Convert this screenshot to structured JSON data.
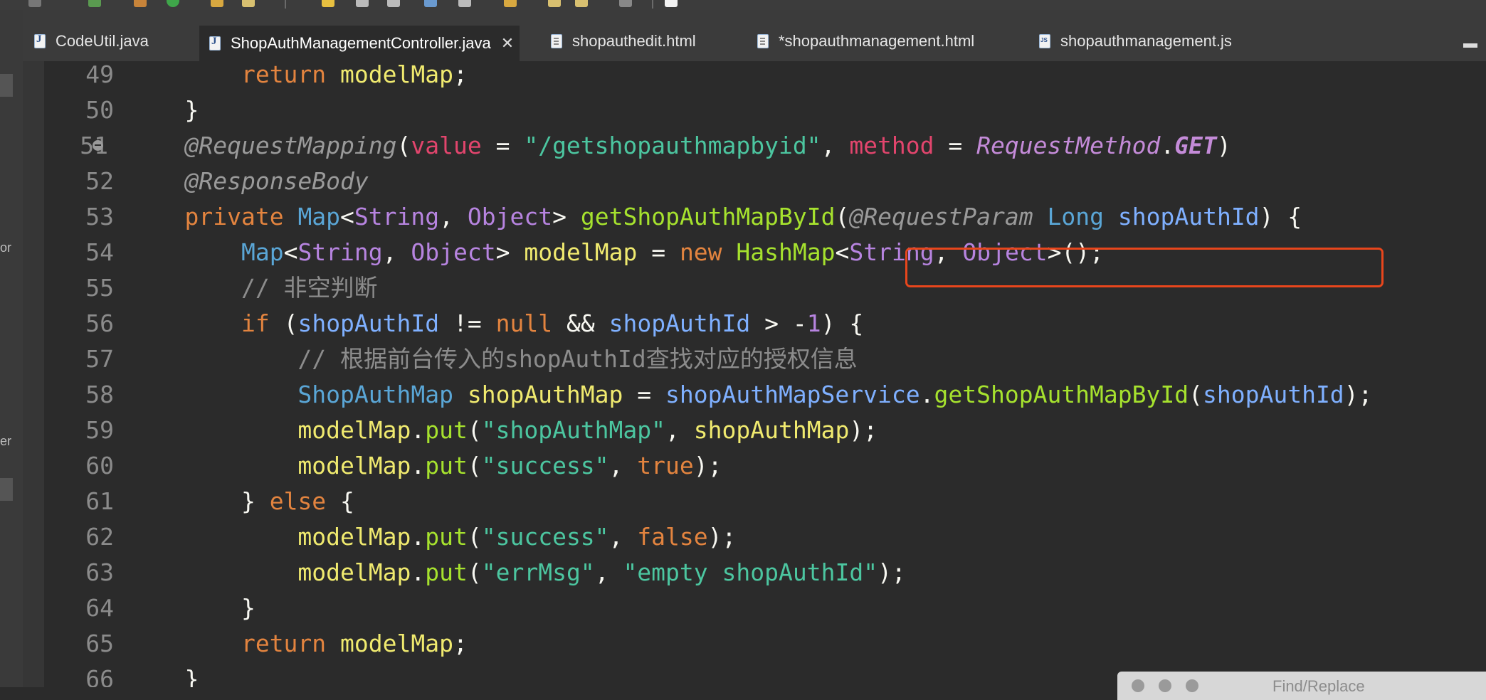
{
  "tabs": [
    {
      "label": "CodeUtil.java",
      "icon": "java-file-icon"
    },
    {
      "label": "ShopAuthManagementController.java",
      "icon": "java-file-icon",
      "active": true
    },
    {
      "label": "shopauthedit.html",
      "icon": "html-file-icon"
    },
    {
      "label": "*shopauthmanagement.html",
      "icon": "html-file-icon"
    },
    {
      "label": "shopauthmanagement.js",
      "icon": "js-file-icon"
    }
  ],
  "left_panel": {
    "fragment_1": "or",
    "fragment_2": "er"
  },
  "editor": {
    "line_numbers": [
      "49",
      "50",
      "51",
      "52",
      "53",
      "54",
      "55",
      "56",
      "57",
      "58",
      "59",
      "60",
      "61",
      "62",
      "63",
      "64",
      "65",
      "66"
    ],
    "highlighted_param": "@RequestParam Long shopAuthId",
    "code": {
      "l49": {
        "kw": "return",
        "var": "modelMap",
        "end": ";"
      },
      "l50": {
        "text": "}"
      },
      "l51": {
        "ann": "@RequestMapping",
        "open": "(",
        "k1": "value",
        "eq": " = ",
        "s1": "\"/getshopauthmapbyid\"",
        "comma": ", ",
        "k2": "method",
        "eq2": " = ",
        "e1": "RequestMethod",
        "dot": ".",
        "e2": "GET",
        "close": ")"
      },
      "l52": {
        "ann": "@ResponseBody"
      },
      "l53": {
        "kw": "private",
        "t1": "Map",
        "lt": "<",
        "g1": "String",
        "comma": ", ",
        "g2": "Object",
        "gt": ">",
        "fn": "getShopAuthMapById",
        "open": "(",
        "ann": "@RequestParam",
        "t2": "Long",
        "par": "shopAuthId",
        "close": ")",
        "brace": " {"
      },
      "l54": {
        "t1": "Map",
        "lt": "<",
        "g1": "String",
        "comma": ", ",
        "g2": "Object",
        "gt": ">",
        "var": "modelMap",
        "eq": " = ",
        "kw": "new",
        "fn": "HashMap",
        "lt2": "<",
        "g3": "String",
        "comma2": ", ",
        "g4": "Object",
        "end": ">();"
      },
      "l55": {
        "cmt": "// 非空判断"
      },
      "l56": {
        "kw": "if",
        "open": " (",
        "p1": "shopAuthId",
        "op1": " != ",
        "lit": "null",
        "op2": " && ",
        "p2": "shopAuthId",
        "op3": " > -",
        "num": "1",
        "close": ") {"
      },
      "l57": {
        "cmt": "// 根据前台传入的shopAuthId查找对应的授权信息"
      },
      "l58": {
        "t1": "ShopAuthMap",
        "var": "shopAuthMap",
        "eq": " = ",
        "p1": "shopAuthMapService",
        "dot": ".",
        "fn": "getShopAuthMapById",
        "open": "(",
        "p2": "shopAuthId",
        "end": ");"
      },
      "l59": {
        "var": "modelMap",
        "dot": ".",
        "fn": "put",
        "open": "(",
        "s1": "\"shopAuthMap\"",
        "comma": ", ",
        "v2": "shopAuthMap",
        "end": ");"
      },
      "l60": {
        "var": "modelMap",
        "dot": ".",
        "fn": "put",
        "open": "(",
        "s1": "\"success\"",
        "comma": ", ",
        "lit": "true",
        "end": ");"
      },
      "l61": {
        "b1": "} ",
        "kw": "else",
        "b2": " {"
      },
      "l62": {
        "var": "modelMap",
        "dot": ".",
        "fn": "put",
        "open": "(",
        "s1": "\"success\"",
        "comma": ", ",
        "lit": "false",
        "end": ");"
      },
      "l63": {
        "var": "modelMap",
        "dot": ".",
        "fn": "put",
        "open": "(",
        "s1": "\"errMsg\"",
        "comma": ", ",
        "s2": "\"empty shopAuthId\"",
        "end": ");"
      },
      "l64": {
        "text": "}"
      },
      "l65": {
        "kw": "return",
        "var": "modelMap",
        "end": ";"
      },
      "l66": {
        "text": "}"
      }
    }
  },
  "find_replace": {
    "title": "Find/Replace"
  },
  "colors": {
    "background": "#2b2b2b",
    "keyword": "#e3843f",
    "function": "#a6e22e",
    "string": "#4cc6a0",
    "type": "#5aa6d6",
    "highlight_box": "#e8461c"
  }
}
